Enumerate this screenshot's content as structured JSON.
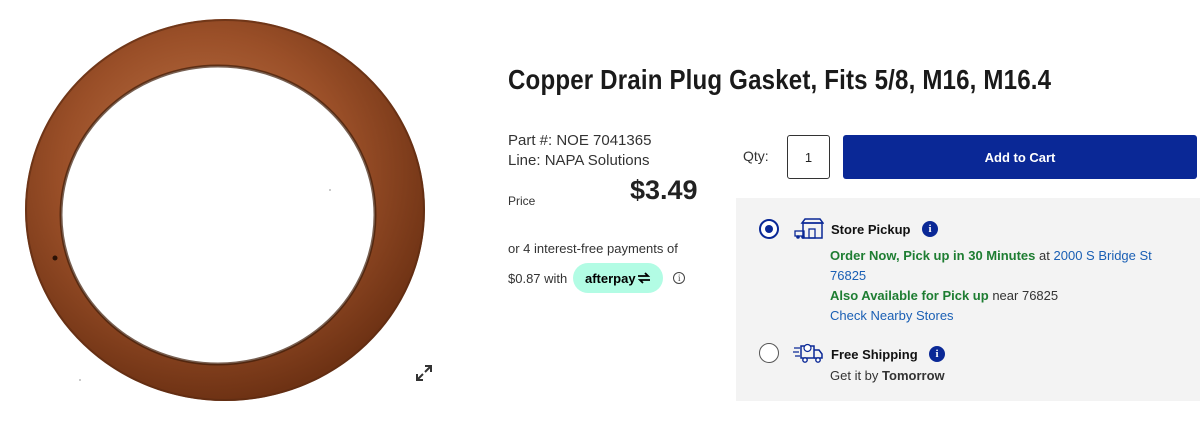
{
  "product": {
    "title": "Copper Drain Plug Gasket, Fits 5/8, M16, M16.4",
    "part_number": "Part #: NOE 7041365",
    "line": "Line: NAPA Solutions",
    "price_label": "Price",
    "price": "$3.49",
    "image_icon": "expand-icon"
  },
  "afterpay": {
    "installments_text": "or 4 interest-free payments of",
    "amount_text": "$0.87 with",
    "badge": "afterpay",
    "info_icon": "info-icon"
  },
  "cart": {
    "qty_label": "Qty:",
    "qty_value": "1",
    "add_label": "Add to Cart",
    "button_color": "#0a2896"
  },
  "fulfillment": {
    "store_pickup": {
      "title": "Store Pickup",
      "icon": "store-icon",
      "selected": true,
      "order_now": "Order Now, Pick up in 30 Minutes",
      "at": "at",
      "address": "2000 S Bridge St",
      "zip": "76825",
      "also_available": "Also Available for Pick up",
      "near": "near 76825",
      "check_stores": "Check Nearby Stores"
    },
    "free_shipping": {
      "title": "Free Shipping",
      "icon": "shipping-truck-icon",
      "selected": false,
      "get_it_by": "Get it by",
      "when": "Tomorrow"
    }
  },
  "colors": {
    "accent": "#0a2896",
    "available_green": "#1e7d32",
    "link": "#1a5fb4",
    "afterpay_mint": "#b2fce4",
    "panel_bg": "#f3f3f3"
  }
}
